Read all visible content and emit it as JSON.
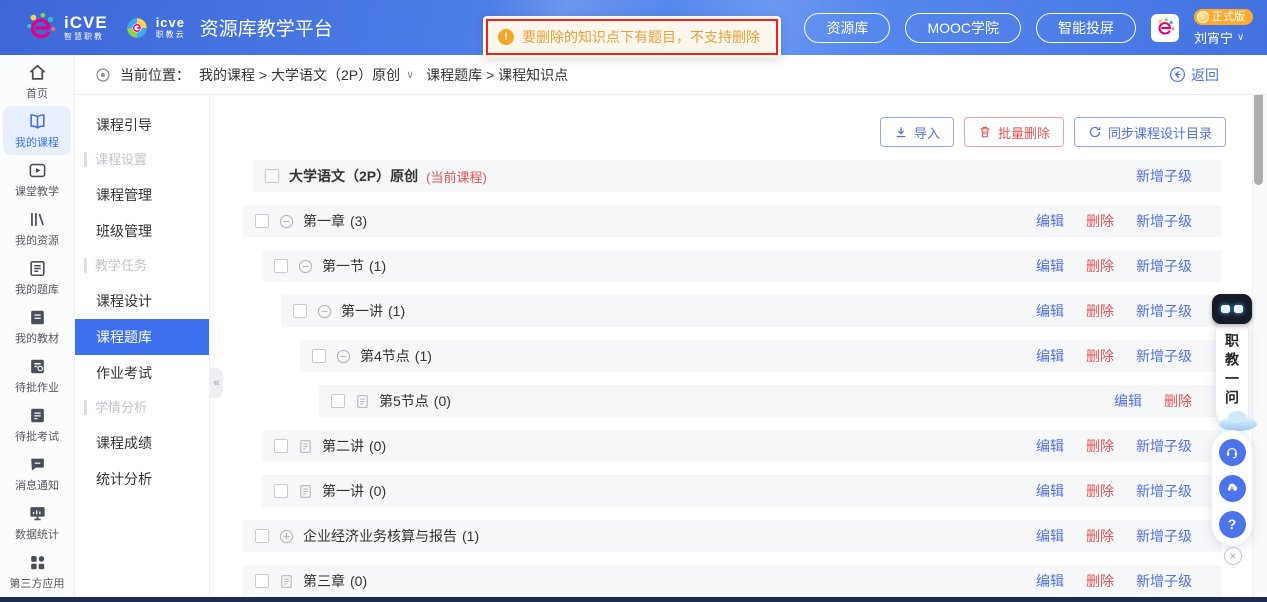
{
  "header": {
    "logo1": {
      "text": "iCVE",
      "sub": "智慧职教"
    },
    "logo2": {
      "text": "icve",
      "sub": "职教云"
    },
    "app_title": "资源库教学平台",
    "toast": {
      "text": "要删除的知识点下有题目，不支持删除"
    },
    "nav_buttons": [
      "资源库",
      "MOOC学院",
      "智能投屏"
    ],
    "user": {
      "badge": "正式版",
      "name": "刘宵宁",
      "caret": "∨"
    }
  },
  "left_rail": {
    "items": [
      {
        "label": "首页",
        "icon": "home",
        "active": false
      },
      {
        "label": "我的课程",
        "icon": "book",
        "active": true
      },
      {
        "label": "课堂教学",
        "icon": "play",
        "active": false
      },
      {
        "label": "我的资源",
        "icon": "shelf",
        "active": false
      },
      {
        "label": "我的题库",
        "icon": "bank",
        "active": false
      },
      {
        "label": "我的教材",
        "icon": "textbook",
        "active": false
      },
      {
        "label": "待批作业",
        "icon": "homework",
        "active": false
      },
      {
        "label": "待批考试",
        "icon": "exam",
        "active": false
      },
      {
        "label": "消息通知",
        "icon": "message",
        "active": false
      },
      {
        "label": "数据统计",
        "icon": "stats",
        "active": false
      },
      {
        "label": "第三方应用",
        "icon": "apps",
        "active": false
      }
    ]
  },
  "breadcrumb": {
    "prefix": "当前位置：",
    "path1": "我的课程 > 大学语文（2P）原创",
    "caret": "∨",
    "path2": "课程题库 > 课程知识点",
    "back": "返回"
  },
  "sidebar": {
    "collapse_glyph": "«",
    "items": [
      {
        "label": "课程引导",
        "type": "item"
      },
      {
        "label": "课程设置",
        "type": "section"
      },
      {
        "label": "课程管理",
        "type": "item"
      },
      {
        "label": "班级管理",
        "type": "item"
      },
      {
        "label": "教学任务",
        "type": "section"
      },
      {
        "label": "课程设计",
        "type": "item"
      },
      {
        "label": "课程题库",
        "type": "item",
        "active": true
      },
      {
        "label": "作业考试",
        "type": "item"
      },
      {
        "label": "学情分析",
        "type": "section"
      },
      {
        "label": "课程成绩",
        "type": "item"
      },
      {
        "label": "统计分析",
        "type": "item"
      }
    ]
  },
  "toolbar": {
    "import_label": "导入",
    "batch_delete_label": "批量删除",
    "sync_label": "同步课程设计目录"
  },
  "tree": {
    "action_labels": {
      "edit": "编辑",
      "delete": "删除",
      "add": "新增子级"
    },
    "rows": [
      {
        "label": "大学语文（2P）原创",
        "count": null,
        "tag": "(当前课程)",
        "level": 0,
        "root": true,
        "icon": "none",
        "bold": true,
        "actions": [
          "add"
        ]
      },
      {
        "label": "第一章",
        "count": 3,
        "level": 0,
        "icon": "minus",
        "actions": [
          "edit",
          "delete",
          "add"
        ]
      },
      {
        "label": "第一节",
        "count": 1,
        "level": 1,
        "icon": "minus",
        "actions": [
          "edit",
          "delete",
          "add"
        ]
      },
      {
        "label": "第一讲",
        "count": 1,
        "level": 2,
        "icon": "minus",
        "actions": [
          "edit",
          "delete",
          "add"
        ]
      },
      {
        "label": "第4节点",
        "count": 1,
        "level": 3,
        "icon": "minus",
        "actions": [
          "edit",
          "delete",
          "add"
        ]
      },
      {
        "label": "第5节点",
        "count": 0,
        "level": 4,
        "icon": "doc",
        "actions": [
          "edit",
          "delete"
        ]
      },
      {
        "label": "第二讲",
        "count": 0,
        "level": 1,
        "icon": "doc",
        "actions": [
          "edit",
          "delete",
          "add"
        ]
      },
      {
        "label": "第一讲",
        "count": 0,
        "level": 1,
        "icon": "doc",
        "actions": [
          "edit",
          "delete",
          "add"
        ]
      },
      {
        "label": "企业经济业务核算与报告",
        "count": 1,
        "level": 0,
        "icon": "plus",
        "actions": [
          "edit",
          "delete",
          "add"
        ]
      },
      {
        "label": "第三章",
        "count": 0,
        "level": 0,
        "icon": "doc",
        "actions": [
          "edit",
          "delete",
          "add"
        ]
      }
    ]
  },
  "floating": {
    "assistant_label": "职教一问",
    "question_glyph": "?",
    "close_glyph": "×"
  },
  "colors": {
    "accent": "#3e70ee",
    "link_blue": "#5272e0",
    "danger": "#e25555",
    "toast_bg": "#fdf6ec",
    "toast_text": "#e6a23c",
    "badge_orange": "#ffaa2e",
    "header_blue": "#4b7ce6"
  }
}
